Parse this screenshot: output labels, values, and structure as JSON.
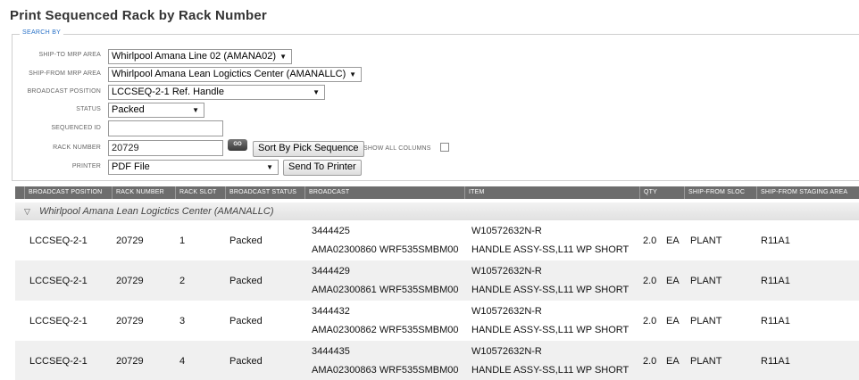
{
  "page": {
    "title": "Print Sequenced Rack by Rack Number"
  },
  "search": {
    "legend": "SEARCH BY",
    "ship_to": {
      "label": "SHIP-TO MRP AREA",
      "value": "Whirlpool Amana Line 02 (AMANA02)"
    },
    "ship_from": {
      "label": "SHIP-FROM MRP AREA",
      "value": "Whirlpool Amana Lean Logictics Center (AMANALLC)"
    },
    "broadcast_position": {
      "label": "BROADCAST POSITION",
      "value": "LCCSEQ-2-1 Ref. Handle"
    },
    "status": {
      "label": "STATUS",
      "value": "Packed"
    },
    "sequenced_id": {
      "label": "SEQUENCED ID",
      "value": ""
    },
    "rack_number": {
      "label": "RACK NUMBER",
      "value": "20729"
    },
    "go_label": "GO",
    "sort_label": "Sort By Pick Sequence",
    "show_all_label": "SHOW ALL COLUMNS",
    "printer": {
      "label": "PRINTER",
      "value": "PDF File"
    },
    "send_label": "Send To Printer"
  },
  "grid": {
    "columns": [
      "BROADCAST POSITION",
      "RACK NUMBER",
      "RACK SLOT",
      "BROADCAST STATUS",
      "BROADCAST",
      "ITEM",
      "QTY",
      "SHIP-FROM SLOC",
      "SHIP-FROM STAGING AREA"
    ],
    "group_label": "Whirlpool Amana Lean Logictics Center (AMANALLC)",
    "rows": [
      {
        "position": "LCCSEQ-2-1",
        "rack": "20729",
        "slot": "1",
        "status": "Packed",
        "broadcast": "3444425",
        "broadcast_detail": "AMA02300860 WRF535SMBM00",
        "item": "W10572632N-R",
        "item_desc": "HANDLE ASSY-SS,L11 WP SHORT",
        "qty": "2.0",
        "uom": "EA",
        "sloc": "PLANT",
        "staging": "R11A1"
      },
      {
        "position": "LCCSEQ-2-1",
        "rack": "20729",
        "slot": "2",
        "status": "Packed",
        "broadcast": "3444429",
        "broadcast_detail": "AMA02300861 WRF535SMBM00",
        "item": "W10572632N-R",
        "item_desc": "HANDLE ASSY-SS,L11 WP SHORT",
        "qty": "2.0",
        "uom": "EA",
        "sloc": "PLANT",
        "staging": "R11A1"
      },
      {
        "position": "LCCSEQ-2-1",
        "rack": "20729",
        "slot": "3",
        "status": "Packed",
        "broadcast": "3444432",
        "broadcast_detail": "AMA02300862 WRF535SMBM00",
        "item": "W10572632N-R",
        "item_desc": "HANDLE ASSY-SS,L11 WP SHORT",
        "qty": "2.0",
        "uom": "EA",
        "sloc": "PLANT",
        "staging": "R11A1"
      },
      {
        "position": "LCCSEQ-2-1",
        "rack": "20729",
        "slot": "4",
        "status": "Packed",
        "broadcast": "3444435",
        "broadcast_detail": "AMA02300863 WRF535SMBM00",
        "item": "W10572632N-R",
        "item_desc": "HANDLE ASSY-SS,L11 WP SHORT",
        "qty": "2.0",
        "uom": "EA",
        "sloc": "PLANT",
        "staging": "R11A1"
      }
    ]
  }
}
